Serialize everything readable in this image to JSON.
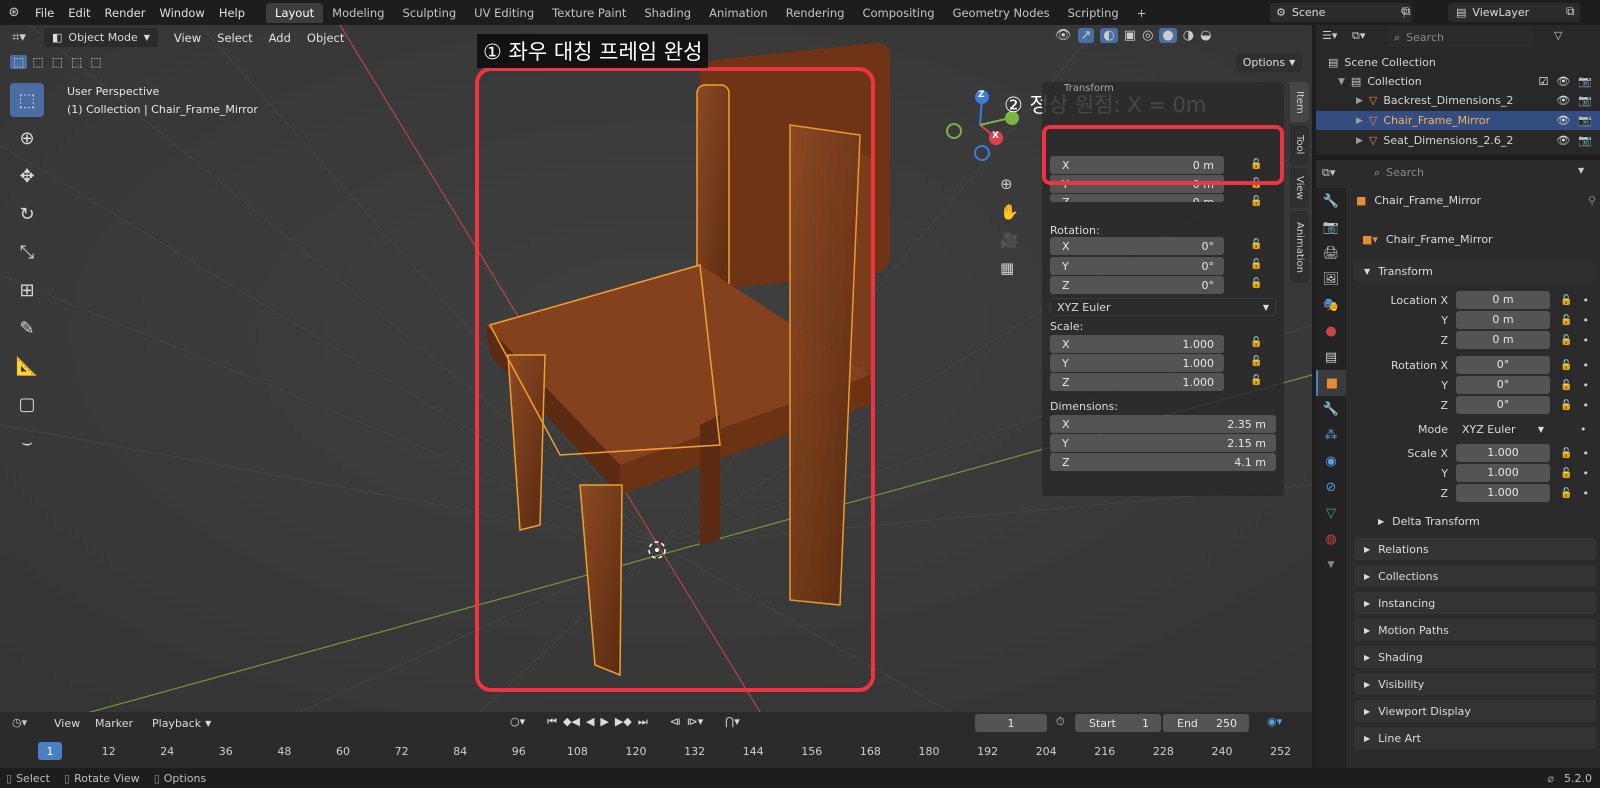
{
  "topbar": {
    "menus": [
      "File",
      "Edit",
      "Render",
      "Window",
      "Help"
    ],
    "workspaces": [
      "Layout",
      "Modeling",
      "Sculpting",
      "UV Editing",
      "Texture Paint",
      "Shading",
      "Animation",
      "Rendering",
      "Compositing",
      "Geometry Nodes",
      "Scripting"
    ],
    "active_workspace": "Layout",
    "scene": "Scene",
    "view_layer": "ViewLayer"
  },
  "viewport": {
    "mode": "Object Mode",
    "menus": [
      "View",
      "Select",
      "Add",
      "Object"
    ],
    "options_label": "Options",
    "perspective": "User Perspective",
    "collection_info": "(1) Collection | Chair_Frame_Mirror",
    "gizmo": {
      "x": "X",
      "y": "Y",
      "z": "Z"
    }
  },
  "annotations": {
    "frame_label": "① 좌우 대칭 프레임 완성",
    "origin_label": "② 정상 원점: X = 0m"
  },
  "npanel": {
    "header": "Transform",
    "location": [
      {
        "axis": "X",
        "value": "0 m"
      },
      {
        "axis": "Y",
        "value": "0 m"
      },
      {
        "axis": "Z",
        "value": "0 m"
      }
    ],
    "rotation_label": "Rotation:",
    "rotation": [
      {
        "axis": "X",
        "value": "0°"
      },
      {
        "axis": "Y",
        "value": "0°"
      },
      {
        "axis": "Z",
        "value": "0°"
      }
    ],
    "rotation_mode": "XYZ Euler",
    "scale_label": "Scale:",
    "scale": [
      {
        "axis": "X",
        "value": "1.000"
      },
      {
        "axis": "Y",
        "value": "1.000"
      },
      {
        "axis": "Z",
        "value": "1.000"
      }
    ],
    "dimensions_label": "Dimensions:",
    "dimensions": [
      {
        "axis": "X",
        "value": "2.35 m"
      },
      {
        "axis": "Y",
        "value": "2.15 m"
      },
      {
        "axis": "Z",
        "value": "4.1 m"
      }
    ],
    "tabs": [
      "Item",
      "Tool",
      "View",
      "Animation"
    ]
  },
  "outliner": {
    "search_placeholder": "Search",
    "scene_collection": "Scene Collection",
    "collection": "Collection",
    "items": [
      "Backrest_Dimensions_2",
      "Chair_Frame_Mirror",
      "Seat_Dimensions_2.6_2"
    ],
    "selected": "Chair_Frame_Mirror"
  },
  "properties": {
    "search_placeholder": "Search",
    "object_name": "Chair_Frame_Mirror",
    "data_name": "Chair_Frame_Mirror",
    "transform_header": "Transform",
    "location_label": "Location X",
    "location": [
      "0 m",
      "0 m",
      "0 m"
    ],
    "rotation_label": "Rotation X",
    "rotation": [
      "0°",
      "0°",
      "0°"
    ],
    "mode_label": "Mode",
    "mode_value": "XYZ Euler",
    "scale_label": "Scale X",
    "scale": [
      "1.000",
      "1.000",
      "1.000"
    ],
    "axis_y": "Y",
    "axis_z": "Z",
    "delta_transform": "Delta Transform",
    "panels": [
      "Relations",
      "Collections",
      "Instancing",
      "Motion Paths",
      "Shading",
      "Visibility",
      "Viewport Display",
      "Line Art"
    ]
  },
  "timeline": {
    "menus": [
      "View",
      "Marker"
    ],
    "playback": "Playback",
    "current_frame": "1",
    "start_label": "Start",
    "start": "1",
    "end_label": "End",
    "end": "250",
    "ticks": [
      "1",
      "12",
      "24",
      "36",
      "48",
      "60",
      "72",
      "84",
      "96",
      "108",
      "120",
      "132",
      "144",
      "156",
      "168",
      "180",
      "192",
      "204",
      "216",
      "228",
      "240",
      "252"
    ]
  },
  "statusbar": {
    "select": "Select",
    "rotate_view": "Rotate View",
    "options": "Options",
    "version": "5.2.0"
  },
  "colors": {
    "selection_blue": "#334d80",
    "annotation_red": "#ef3340",
    "chair_brown": "#7a3c1a",
    "outline_orange": "#f0a030"
  }
}
